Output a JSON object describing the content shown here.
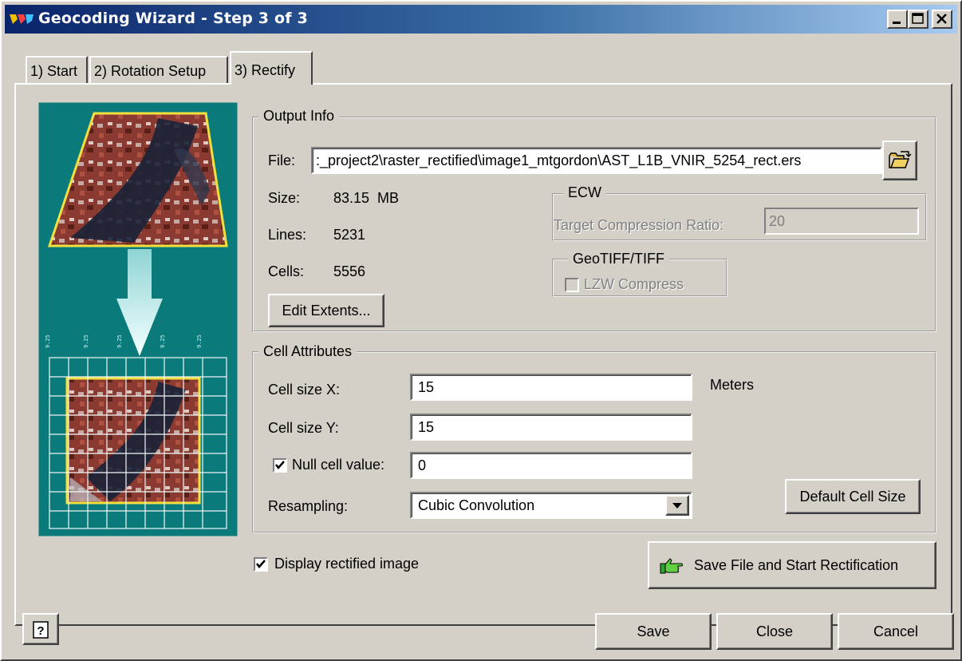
{
  "window": {
    "title": "Geocoding Wizard - Step 3 of 3",
    "controls": {
      "minimize": "_",
      "maximize": "□",
      "close": "×"
    }
  },
  "tabs": [
    {
      "label": "1) Start"
    },
    {
      "label": "2) Rotation Setup"
    },
    {
      "label": "3) Rectify",
      "active": true
    }
  ],
  "output_info": {
    "group_label": "Output Info",
    "file_label": "File:",
    "file_value": ":_project2\\raster_rectified\\image1_mtgordon\\AST_L1B_VNIR_5254_rect.ers",
    "size_label": "Size:",
    "size_value": "83.15  MB",
    "lines_label": "Lines:",
    "lines_value": "5231",
    "cells_label": "Cells:",
    "cells_value": "5556",
    "edit_extents": "Edit Extents...",
    "browse_icon": "folder-open-icon"
  },
  "ecw": {
    "group_label": "ECW",
    "ratio_label": "Target Compression Ratio:",
    "ratio_value": "20"
  },
  "geotiff": {
    "group_label": "GeoTIFF/TIFF",
    "lzw_label": "LZW Compress",
    "lzw_checked": false
  },
  "cell_attributes": {
    "group_label": "Cell Attributes",
    "cell_x_label": "Cell size X:",
    "cell_x_value": "15",
    "units": "Meters",
    "cell_y_label": "Cell size Y:",
    "cell_y_value": "15",
    "null_label": "Null cell value:",
    "null_checked": true,
    "null_value": "0",
    "resampling_label": "Resampling:",
    "resampling_value": "Cubic Convolution",
    "default_cell_size": "Default Cell Size"
  },
  "display_rectified": {
    "label": "Display rectified image",
    "checked": true
  },
  "save_and_start": "Save File and Start Rectification",
  "footer": {
    "save": "Save",
    "close": "Close",
    "cancel": "Cancel",
    "help_icon": "help-icon"
  },
  "colors": {
    "titlebar_start": "#0a246a",
    "titlebar_end": "#a6caf0",
    "face": "#d4d0c8",
    "preview_bg": "#0a7a7a",
    "accent_yellow": "#f0e040"
  }
}
